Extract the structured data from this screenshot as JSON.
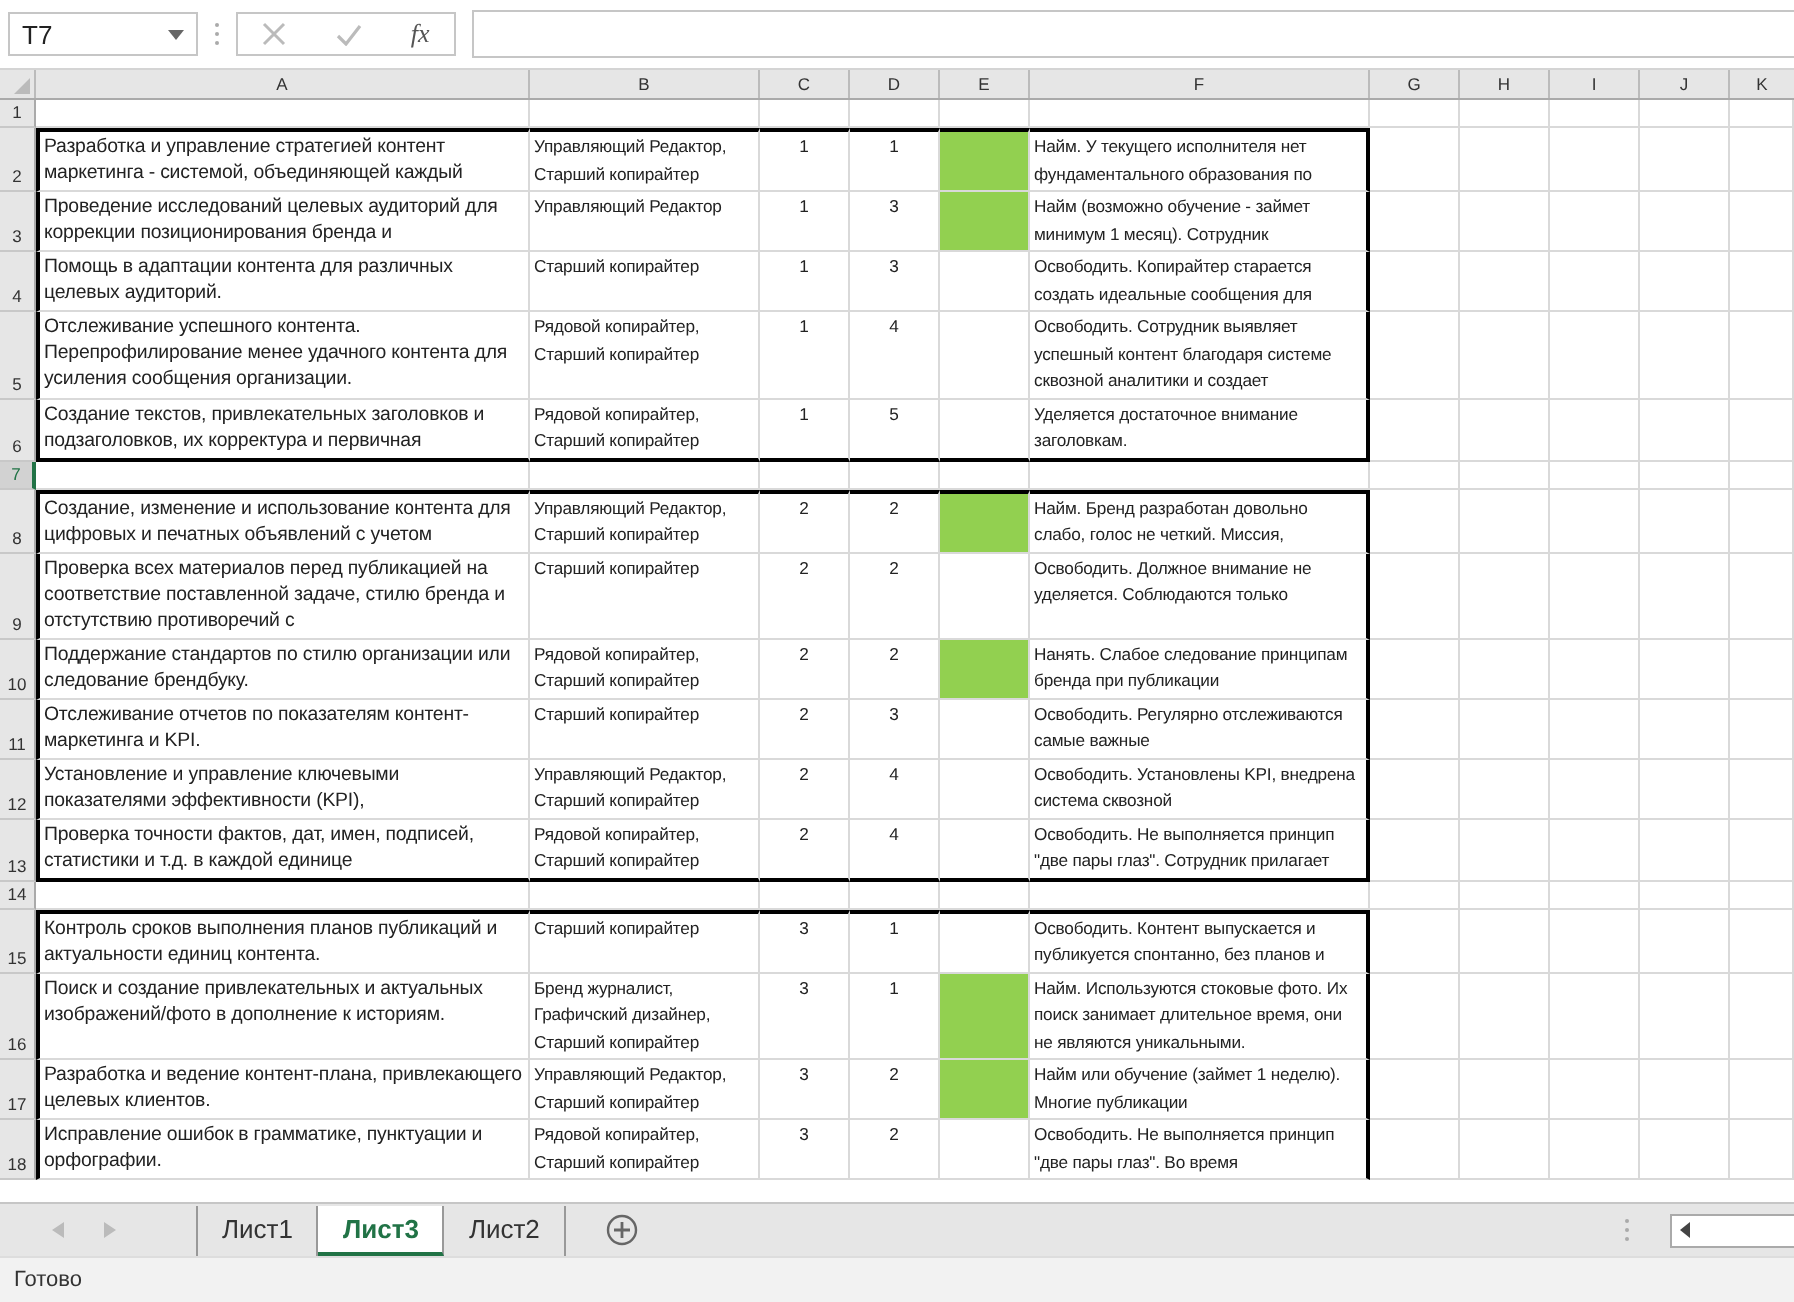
{
  "formula_bar": {
    "name_box": "T7",
    "function_button": "fx"
  },
  "columns": [
    "A",
    "B",
    "C",
    "D",
    "E",
    "F",
    "G",
    "H",
    "I",
    "J",
    "K"
  ],
  "sheet": [
    {
      "kind": "blank",
      "row": "1",
      "selected": false
    },
    {
      "kind": "group",
      "closed": true,
      "rows": [
        {
          "row": "2",
          "selected": false,
          "task": "Разработка и управление стратегией контент маркетинга - системой, объединяющей каждый",
          "roles": "Управляющий Редактор, Старший копирайтер",
          "c": "1",
          "d": "1",
          "highlighted": true,
          "comment": "Найм. У текущего исполнителя нет фундаментального образования по"
        },
        {
          "row": "3",
          "selected": false,
          "task": "Проведение исследований целевых аудиторий для коррекции позиционирования бренда и",
          "roles": "Управляющий Редактор",
          "c": "1",
          "d": "3",
          "highlighted": true,
          "comment": "Найм (возможно обучение - займет минимум 1 месяц). Сотрудник"
        },
        {
          "row": "4",
          "selected": false,
          "task": "Помощь в адаптации контента для различных целевых аудиторий.",
          "roles": "Старший копирайтер",
          "c": "1",
          "d": "3",
          "highlighted": false,
          "comment": "Освободить. Копирайтер старается создать идеальные сообщения для"
        },
        {
          "row": "5",
          "selected": false,
          "task": "Отслеживание успешного контента. Перепрофилирование менее удачного контента для усиления сообщения организации.",
          "roles": "Рядовой копирайтер, Старший копирайтер",
          "c": "1",
          "d": "4",
          "highlighted": false,
          "comment": "Освободить. Сотрудник выявляет успешный контент благодаря системе сквозной аналитики и создает"
        },
        {
          "row": "6",
          "selected": false,
          "task": "Создание текстов, привлекательных заголовков и подзаголовков, их корректура и первичная",
          "roles": "Рядовой копирайтер, Старший копирайтер",
          "c": "1",
          "d": "5",
          "highlighted": false,
          "comment": "Уделяется достаточное внимание заголовкам."
        }
      ]
    },
    {
      "kind": "blank",
      "row": "7",
      "selected": true
    },
    {
      "kind": "group",
      "closed": true,
      "rows": [
        {
          "row": "8",
          "selected": false,
          "task": "Создание, изменение и использование контента для цифровых и печатных объявлений  с учетом",
          "roles": "Управляющий Редактор, Старший копирайтер",
          "c": "2",
          "d": "2",
          "highlighted": true,
          "comment": "Найм. Бренд разработан довольно слабо, голос не четкий. Миссия,"
        },
        {
          "row": "9",
          "selected": false,
          "task": "Проверка всех материалов перед публикацией на соответствие поставленной задаче, стилю бренда и отстутствию противоречий с",
          "roles": "Старший копирайтер",
          "c": "2",
          "d": "2",
          "highlighted": false,
          "comment": "Освободить. Должное внимание не уделяется. Соблюдаются только"
        },
        {
          "row": "10",
          "selected": false,
          "task": "Поддержание стандартов по стилю организации или следование брендбуку.",
          "roles": "Рядовой копирайтер, Старший копирайтер",
          "c": "2",
          "d": "2",
          "highlighted": true,
          "comment": "Нанять. Слабое следование принципам бренда при публикации"
        },
        {
          "row": "11",
          "selected": false,
          "task": "Отслеживание отчетов по показателям контент-маркетинга и KPI.",
          "roles": "Старший копирайтер",
          "c": "2",
          "d": "3",
          "highlighted": false,
          "comment": "Освободить. Регулярно отслеживаются самые важные"
        },
        {
          "row": "12",
          "selected": false,
          "task": "Установление и управление ключевыми показателями эффективности (KPI),",
          "roles": "Управляющий Редактор, Старший копирайтер",
          "c": "2",
          "d": "4",
          "highlighted": false,
          "comment": "Освободить. Установлены KPI, внедрена система сквозной"
        },
        {
          "row": "13",
          "selected": false,
          "task": "Проверка точности фактов, дат, имен, подписей, статистики и т.д. в каждой единице",
          "roles": "Рядовой копирайтер, Старший копирайтер",
          "c": "2",
          "d": "4",
          "highlighted": false,
          "comment": "Освободить. Не выполняется принцип \"две пары глаз\". Сотрудник прилагает"
        }
      ]
    },
    {
      "kind": "blank",
      "row": "14",
      "selected": false
    },
    {
      "kind": "group",
      "closed": false,
      "rows": [
        {
          "row": "15",
          "selected": false,
          "task": "Контроль сроков выполнения планов публикаций и актуальности единиц контента.",
          "roles": "Старший копирайтер",
          "c": "3",
          "d": "1",
          "highlighted": false,
          "comment": "Освободить. Контент выпускается и публикуется спонтанно, без планов и"
        },
        {
          "row": "16",
          "selected": false,
          "task": "Поиск и создание привлекательных и актуальных изображений/фото в дополнение к историям.",
          "roles": "Бренд журналист, Графичский дизайнер, Старший копирайтер",
          "c": "3",
          "d": "1",
          "highlighted": true,
          "comment": "Найм. Используются стоковые фото. Их поиск занимает длительное время, они не являются уникальными."
        },
        {
          "row": "17",
          "selected": false,
          "task": "Разработка и ведение контент-плана, привлекающего целевых клиентов.",
          "roles": "Управляющий Редактор, Старший копирайтер",
          "c": "3",
          "d": "2",
          "highlighted": true,
          "comment": "Найм или обучение (займет 1 неделю). Многие публикации"
        },
        {
          "row": "18",
          "selected": false,
          "task": "Исправление ошибок в грамматике, пунктуации и орфографии.",
          "roles": "Рядовой копирайтер, Старший копирайтер",
          "c": "3",
          "d": "2",
          "highlighted": false,
          "comment": "Освободить. Не выполняется принцип \"две пары глаз\". Во время"
        }
      ]
    }
  ],
  "sheet_tabs": [
    {
      "label": "Лист1",
      "selected": false
    },
    {
      "label": "Лист3",
      "selected": true
    },
    {
      "label": "Лист2",
      "selected": false
    }
  ],
  "status_bar": "Готово"
}
